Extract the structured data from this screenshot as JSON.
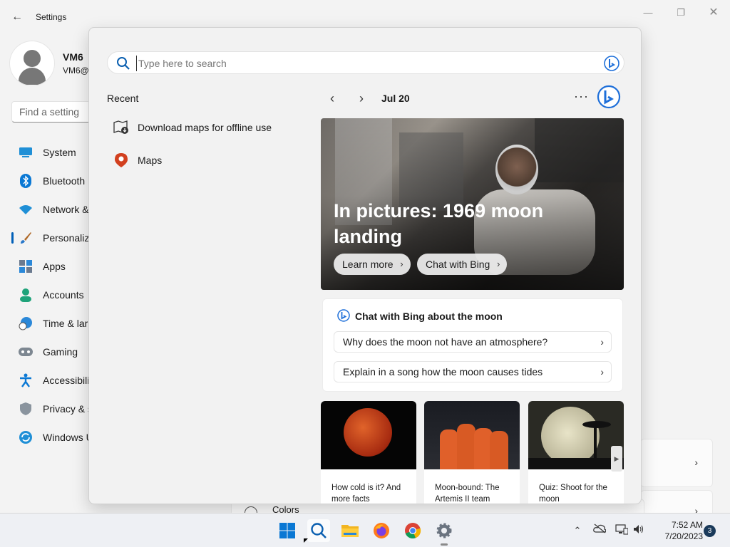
{
  "settings": {
    "title": "Settings",
    "user": {
      "name": "VM6",
      "email": "VM6@"
    },
    "find_placeholder": "Find a setting",
    "nav": [
      {
        "label": "System",
        "icon": "monitor-icon"
      },
      {
        "label": "Bluetooth",
        "icon": "bluetooth-icon"
      },
      {
        "label": "Network &",
        "icon": "wifi-icon"
      },
      {
        "label": "Personaliza",
        "icon": "paintbrush-icon",
        "active": true
      },
      {
        "label": "Apps",
        "icon": "apps-icon"
      },
      {
        "label": "Accounts",
        "icon": "person-icon"
      },
      {
        "label": "Time & lar",
        "icon": "clock-globe-icon"
      },
      {
        "label": "Gaming",
        "icon": "gamepad-icon"
      },
      {
        "label": "Accessibilit",
        "icon": "accessibility-icon"
      },
      {
        "label": "Privacy & s",
        "icon": "shield-icon"
      },
      {
        "label": "Windows U",
        "icon": "update-icon"
      }
    ],
    "colors_label": "Colors"
  },
  "search": {
    "placeholder": "Type here to search",
    "recent_title": "Recent",
    "recent": [
      {
        "label": "Download maps for offline use",
        "icon": "map-download-icon"
      },
      {
        "label": "Maps",
        "icon": "map-pin-icon"
      }
    ],
    "date": "Jul 20",
    "more": "···",
    "hero": {
      "title": "In pictures: 1969 moon landing",
      "learn_more": "Learn more",
      "chat_with_bing": "Chat with Bing"
    },
    "chat": {
      "title": "Chat with Bing about the moon",
      "questions": [
        "Why does the moon not have an atmosphere?",
        "Explain in a song how the moon causes tides"
      ]
    },
    "news": [
      {
        "title": "How cold is it? And more facts"
      },
      {
        "title": "Moon-bound: The Artemis II team"
      },
      {
        "title": "Quiz: Shoot for the moon"
      }
    ]
  },
  "taskbar": {
    "time": "7:52 AM",
    "date": "7/20/2023",
    "notifications": "3"
  },
  "colors": {
    "accent": "#005fb8",
    "bing_blue": "#1e6fd9"
  }
}
